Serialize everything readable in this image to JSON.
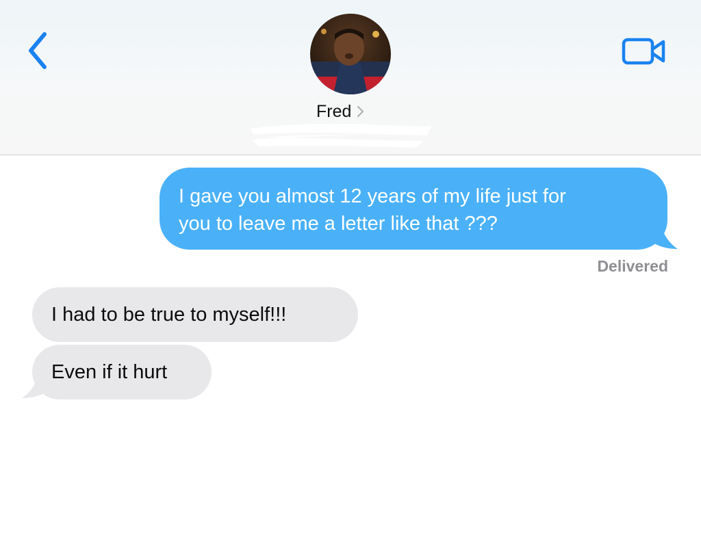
{
  "header": {
    "contact_name": "Fred",
    "back_icon": "chevron-left-icon",
    "video_icon": "video-camera-icon",
    "accent_color": "#1a82f0"
  },
  "messages": [
    {
      "from": "me",
      "lines": [
        "I gave you almost 12 years of my life just for",
        "you to leave me a letter like that ???"
      ]
    },
    {
      "from": "them",
      "text": "I had to be true to myself!!!"
    },
    {
      "from": "them",
      "text": "Even if it hurt"
    }
  ],
  "status": "Delivered",
  "colors": {
    "outgoing": "#4ab1f8",
    "incoming": "#e8e8eb",
    "status": "#8e8e93"
  }
}
